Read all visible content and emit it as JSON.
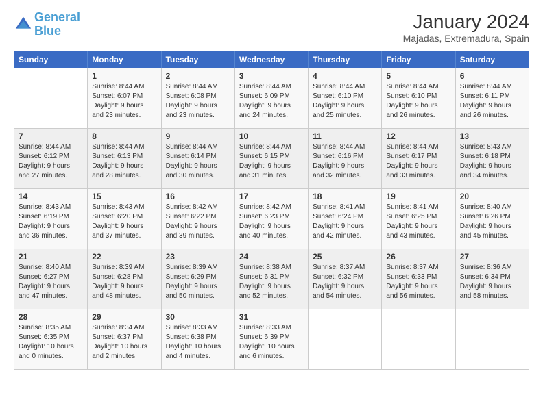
{
  "logo": {
    "text_general": "General",
    "text_blue": "Blue"
  },
  "header": {
    "month": "January 2024",
    "location": "Majadas, Extremadura, Spain"
  },
  "weekdays": [
    "Sunday",
    "Monday",
    "Tuesday",
    "Wednesday",
    "Thursday",
    "Friday",
    "Saturday"
  ],
  "weeks": [
    [
      {
        "day": "",
        "sunrise": "",
        "sunset": "",
        "daylight": ""
      },
      {
        "day": "1",
        "sunrise": "Sunrise: 8:44 AM",
        "sunset": "Sunset: 6:07 PM",
        "daylight": "Daylight: 9 hours and 23 minutes."
      },
      {
        "day": "2",
        "sunrise": "Sunrise: 8:44 AM",
        "sunset": "Sunset: 6:08 PM",
        "daylight": "Daylight: 9 hours and 23 minutes."
      },
      {
        "day": "3",
        "sunrise": "Sunrise: 8:44 AM",
        "sunset": "Sunset: 6:09 PM",
        "daylight": "Daylight: 9 hours and 24 minutes."
      },
      {
        "day": "4",
        "sunrise": "Sunrise: 8:44 AM",
        "sunset": "Sunset: 6:10 PM",
        "daylight": "Daylight: 9 hours and 25 minutes."
      },
      {
        "day": "5",
        "sunrise": "Sunrise: 8:44 AM",
        "sunset": "Sunset: 6:10 PM",
        "daylight": "Daylight: 9 hours and 26 minutes."
      },
      {
        "day": "6",
        "sunrise": "Sunrise: 8:44 AM",
        "sunset": "Sunset: 6:11 PM",
        "daylight": "Daylight: 9 hours and 26 minutes."
      }
    ],
    [
      {
        "day": "7",
        "sunrise": "Sunrise: 8:44 AM",
        "sunset": "Sunset: 6:12 PM",
        "daylight": "Daylight: 9 hours and 27 minutes."
      },
      {
        "day": "8",
        "sunrise": "Sunrise: 8:44 AM",
        "sunset": "Sunset: 6:13 PM",
        "daylight": "Daylight: 9 hours and 28 minutes."
      },
      {
        "day": "9",
        "sunrise": "Sunrise: 8:44 AM",
        "sunset": "Sunset: 6:14 PM",
        "daylight": "Daylight: 9 hours and 30 minutes."
      },
      {
        "day": "10",
        "sunrise": "Sunrise: 8:44 AM",
        "sunset": "Sunset: 6:15 PM",
        "daylight": "Daylight: 9 hours and 31 minutes."
      },
      {
        "day": "11",
        "sunrise": "Sunrise: 8:44 AM",
        "sunset": "Sunset: 6:16 PM",
        "daylight": "Daylight: 9 hours and 32 minutes."
      },
      {
        "day": "12",
        "sunrise": "Sunrise: 8:44 AM",
        "sunset": "Sunset: 6:17 PM",
        "daylight": "Daylight: 9 hours and 33 minutes."
      },
      {
        "day": "13",
        "sunrise": "Sunrise: 8:43 AM",
        "sunset": "Sunset: 6:18 PM",
        "daylight": "Daylight: 9 hours and 34 minutes."
      }
    ],
    [
      {
        "day": "14",
        "sunrise": "Sunrise: 8:43 AM",
        "sunset": "Sunset: 6:19 PM",
        "daylight": "Daylight: 9 hours and 36 minutes."
      },
      {
        "day": "15",
        "sunrise": "Sunrise: 8:43 AM",
        "sunset": "Sunset: 6:20 PM",
        "daylight": "Daylight: 9 hours and 37 minutes."
      },
      {
        "day": "16",
        "sunrise": "Sunrise: 8:42 AM",
        "sunset": "Sunset: 6:22 PM",
        "daylight": "Daylight: 9 hours and 39 minutes."
      },
      {
        "day": "17",
        "sunrise": "Sunrise: 8:42 AM",
        "sunset": "Sunset: 6:23 PM",
        "daylight": "Daylight: 9 hours and 40 minutes."
      },
      {
        "day": "18",
        "sunrise": "Sunrise: 8:41 AM",
        "sunset": "Sunset: 6:24 PM",
        "daylight": "Daylight: 9 hours and 42 minutes."
      },
      {
        "day": "19",
        "sunrise": "Sunrise: 8:41 AM",
        "sunset": "Sunset: 6:25 PM",
        "daylight": "Daylight: 9 hours and 43 minutes."
      },
      {
        "day": "20",
        "sunrise": "Sunrise: 8:40 AM",
        "sunset": "Sunset: 6:26 PM",
        "daylight": "Daylight: 9 hours and 45 minutes."
      }
    ],
    [
      {
        "day": "21",
        "sunrise": "Sunrise: 8:40 AM",
        "sunset": "Sunset: 6:27 PM",
        "daylight": "Daylight: 9 hours and 47 minutes."
      },
      {
        "day": "22",
        "sunrise": "Sunrise: 8:39 AM",
        "sunset": "Sunset: 6:28 PM",
        "daylight": "Daylight: 9 hours and 48 minutes."
      },
      {
        "day": "23",
        "sunrise": "Sunrise: 8:39 AM",
        "sunset": "Sunset: 6:29 PM",
        "daylight": "Daylight: 9 hours and 50 minutes."
      },
      {
        "day": "24",
        "sunrise": "Sunrise: 8:38 AM",
        "sunset": "Sunset: 6:31 PM",
        "daylight": "Daylight: 9 hours and 52 minutes."
      },
      {
        "day": "25",
        "sunrise": "Sunrise: 8:37 AM",
        "sunset": "Sunset: 6:32 PM",
        "daylight": "Daylight: 9 hours and 54 minutes."
      },
      {
        "day": "26",
        "sunrise": "Sunrise: 8:37 AM",
        "sunset": "Sunset: 6:33 PM",
        "daylight": "Daylight: 9 hours and 56 minutes."
      },
      {
        "day": "27",
        "sunrise": "Sunrise: 8:36 AM",
        "sunset": "Sunset: 6:34 PM",
        "daylight": "Daylight: 9 hours and 58 minutes."
      }
    ],
    [
      {
        "day": "28",
        "sunrise": "Sunrise: 8:35 AM",
        "sunset": "Sunset: 6:35 PM",
        "daylight": "Daylight: 10 hours and 0 minutes."
      },
      {
        "day": "29",
        "sunrise": "Sunrise: 8:34 AM",
        "sunset": "Sunset: 6:37 PM",
        "daylight": "Daylight: 10 hours and 2 minutes."
      },
      {
        "day": "30",
        "sunrise": "Sunrise: 8:33 AM",
        "sunset": "Sunset: 6:38 PM",
        "daylight": "Daylight: 10 hours and 4 minutes."
      },
      {
        "day": "31",
        "sunrise": "Sunrise: 8:33 AM",
        "sunset": "Sunset: 6:39 PM",
        "daylight": "Daylight: 10 hours and 6 minutes."
      },
      {
        "day": "",
        "sunrise": "",
        "sunset": "",
        "daylight": ""
      },
      {
        "day": "",
        "sunrise": "",
        "sunset": "",
        "daylight": ""
      },
      {
        "day": "",
        "sunrise": "",
        "sunset": "",
        "daylight": ""
      }
    ]
  ]
}
